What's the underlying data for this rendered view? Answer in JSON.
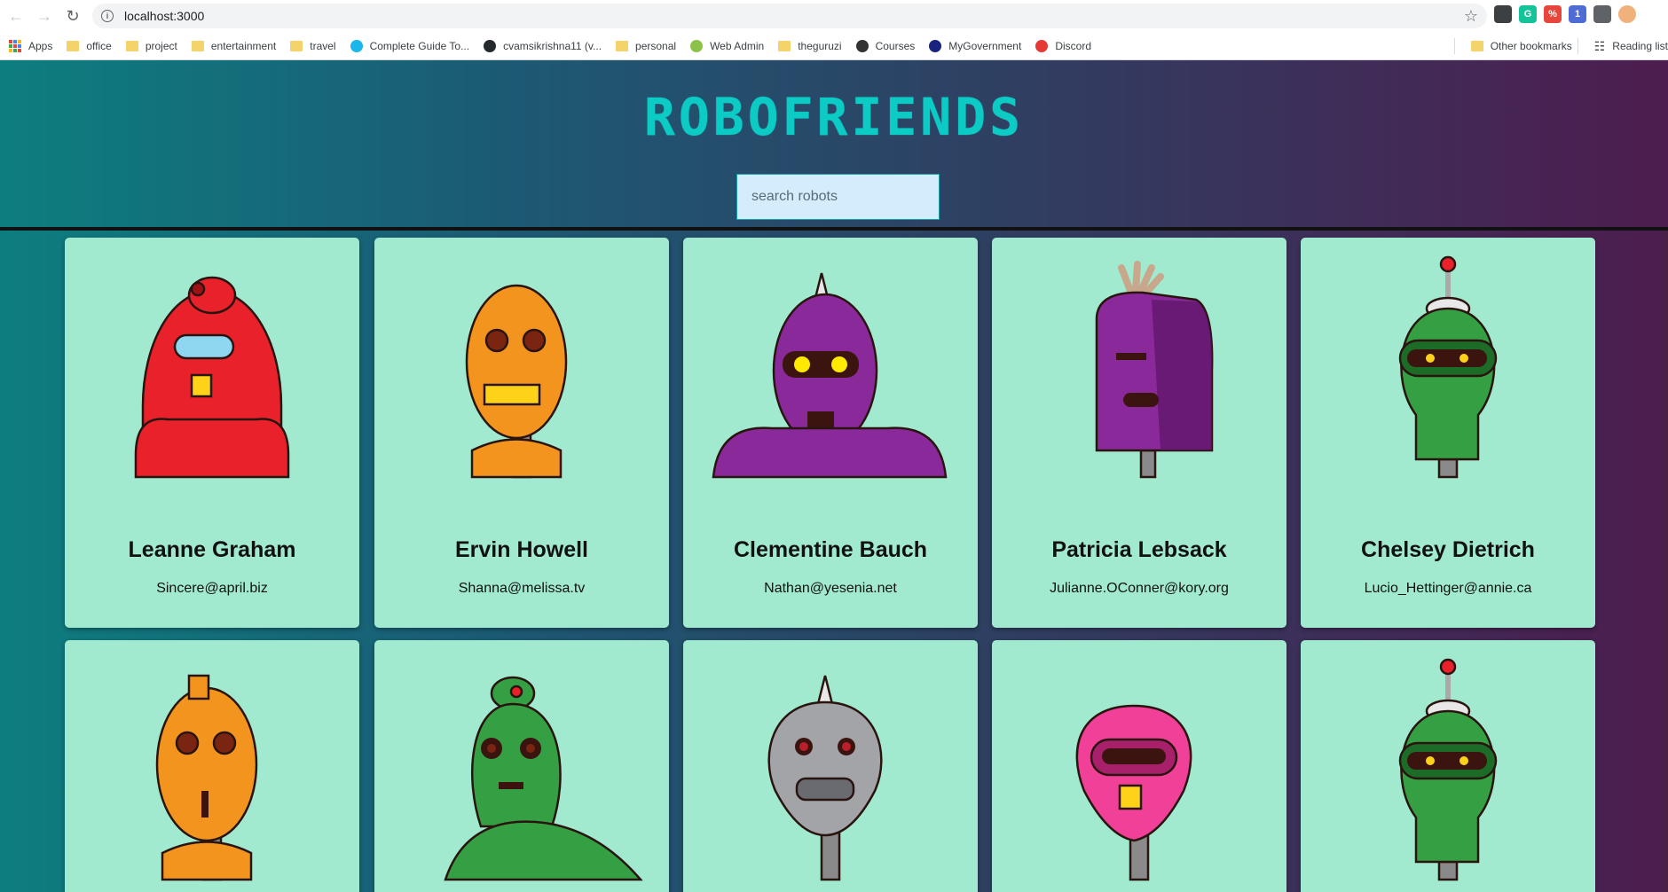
{
  "browser": {
    "url": "localhost:3000",
    "extensions": [
      {
        "name": "extension-icon-1",
        "label": "",
        "color": "#3c4043"
      },
      {
        "name": "grammarly-icon",
        "label": "G",
        "color": "#15c39a"
      },
      {
        "name": "percent-extension-icon",
        "label": "%",
        "color": "#e8453c"
      },
      {
        "name": "gear-extension-icon",
        "label": "1",
        "color": "#4f6bd6"
      },
      {
        "name": "puzzle-icon",
        "label": "",
        "color": "#5f6368"
      }
    ]
  },
  "bookmarks": {
    "items": [
      {
        "label": "Apps",
        "icon": "apps-grid-icon"
      },
      {
        "label": "office",
        "icon": "folder-icon"
      },
      {
        "label": "project",
        "icon": "folder-icon"
      },
      {
        "label": "entertainment",
        "icon": "folder-icon"
      },
      {
        "label": "travel",
        "icon": "folder-icon"
      },
      {
        "label": "Complete Guide To...",
        "icon": "vimeo-icon"
      },
      {
        "label": "cvamsikrishna11 (v...",
        "icon": "github-icon"
      },
      {
        "label": "personal",
        "icon": "folder-icon"
      },
      {
        "label": "Web Admin",
        "icon": "lte-icon"
      },
      {
        "label": "theguruzi",
        "icon": "folder-icon"
      },
      {
        "label": "Courses",
        "icon": "aw-icon"
      },
      {
        "label": "MyGovernment",
        "icon": "mygov-icon"
      },
      {
        "label": "Discord",
        "icon": "discord-icon"
      }
    ],
    "other": "Other bookmarks",
    "reading": "Reading list"
  },
  "app": {
    "title": "ROBOFRIENDS",
    "search_placeholder": "search robots",
    "colors": {
      "title": "#0ccac4",
      "card": "#a1ead0",
      "search_bg": "#d4ecfb"
    },
    "robots": [
      {
        "name": "Leanne Graham",
        "email": "Sincere@april.biz",
        "color": "#e8212a",
        "dark": "#9e1216",
        "eye": "#8fd6f0"
      },
      {
        "name": "Ervin Howell",
        "email": "Shanna@melissa.tv",
        "color": "#f3941f",
        "dark": "#b3620b",
        "eye": "#7a2412"
      },
      {
        "name": "Clementine Bauch",
        "email": "Nathan@yesenia.net",
        "color": "#8a2a9a",
        "dark": "#5a1465",
        "eye": "#ffea00"
      },
      {
        "name": "Patricia Lebsack",
        "email": "Julianne.OConner@kory.org",
        "color": "#8a2a9a",
        "dark": "#5a1465",
        "eye": "#3b1410"
      },
      {
        "name": "Chelsey Dietrich",
        "email": "Lucio_Hettinger@annie.ca",
        "color": "#34a043",
        "dark": "#1c6b27",
        "eye": "#ffd21a"
      },
      {
        "name": "",
        "email": "",
        "color": "#f3941f",
        "dark": "#b3620b",
        "eye": "#7a2412"
      },
      {
        "name": "",
        "email": "",
        "color": "#34a043",
        "dark": "#1c6b27",
        "eye": "#7a2412"
      },
      {
        "name": "",
        "email": "",
        "color": "#a3a4a8",
        "dark": "#6a6b70",
        "eye": "#b8202a"
      },
      {
        "name": "",
        "email": "",
        "color": "#f04098",
        "dark": "#a8206a",
        "eye": "#3b1410"
      },
      {
        "name": "",
        "email": "",
        "color": "#34a043",
        "dark": "#1c6b27",
        "eye": "#ffd21a"
      }
    ]
  }
}
